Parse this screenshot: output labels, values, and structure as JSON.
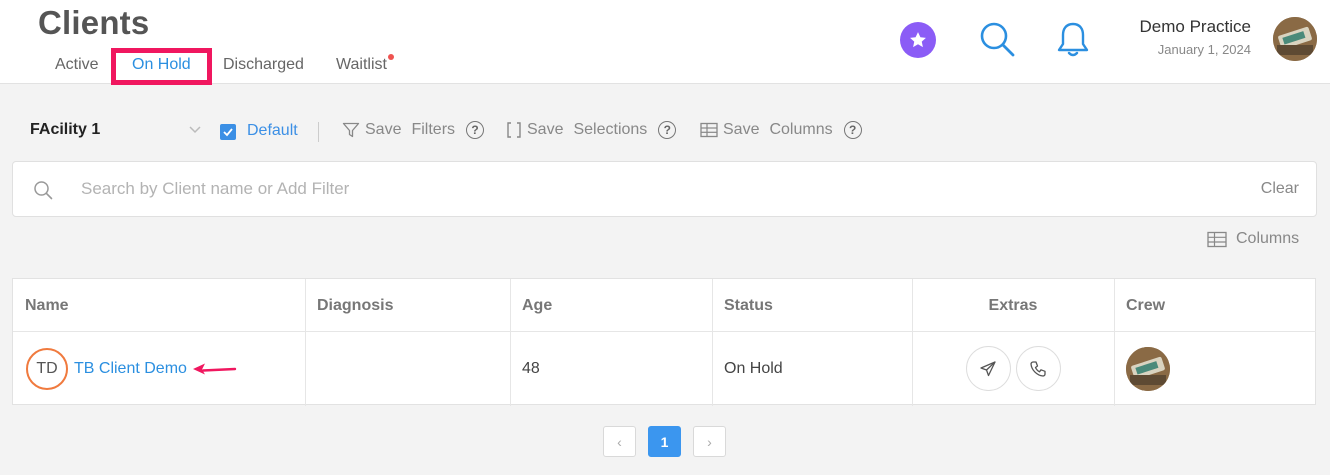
{
  "header": {
    "title": "Clients",
    "tabs": [
      {
        "label": "Active",
        "active": false
      },
      {
        "label": "On Hold",
        "active": true
      },
      {
        "label": "Discharged",
        "active": false
      },
      {
        "label": "Waitlist",
        "active": false,
        "has_notification_dot": true
      }
    ],
    "icons": [
      "star-icon",
      "search-icon",
      "bell-icon"
    ],
    "practice_name": "Demo Practice",
    "practice_date": "January 1, 2024",
    "accent_color": "#8b5cf6",
    "tab_highlight_color": "#f0175f"
  },
  "filters": {
    "facility": "FAcility 1",
    "default_checked": true,
    "default_label": "Default",
    "save_filters": {
      "word1": "Save",
      "word2": "Filters"
    },
    "save_selections": {
      "word1": "Save",
      "word2": "Selections"
    },
    "save_columns": {
      "word1": "Save",
      "word2": "Columns"
    },
    "help_glyph": "?"
  },
  "search": {
    "placeholder": "Search by Client name or Add Filter",
    "value": "",
    "clear_label": "Clear"
  },
  "columns_button": "Columns",
  "table": {
    "headers": [
      "Name",
      "Diagnosis",
      "Age",
      "Status",
      "Extras",
      "Crew"
    ],
    "rows": [
      {
        "initials": "TD",
        "name": "TB Client Demo",
        "diagnosis": "",
        "age": "48",
        "status": "On Hold",
        "extras": [
          "send-icon",
          "phone-icon"
        ]
      }
    ]
  },
  "pagination": {
    "current": "1",
    "prev_glyph": "‹",
    "next_glyph": "›"
  },
  "colors": {
    "link": "#2b8fe0",
    "initials_ring": "#f07a3e",
    "pager_active": "#3b96ef",
    "annotation_arrow": "#f0175f"
  }
}
